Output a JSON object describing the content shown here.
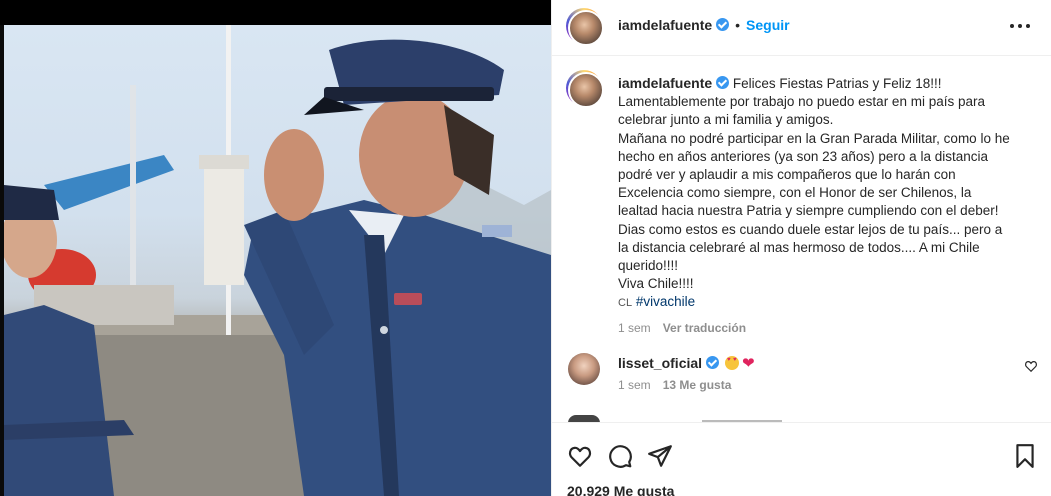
{
  "post": {
    "author": "iamdelafuente",
    "follow_label": "Seguir",
    "caption_author": "iamdelafuente",
    "caption_lines": [
      "Felices Fiestas Patrias y Feliz 18!!!",
      "Lamentablemente por trabajo no puedo estar en mi país para celebrar junto a mi familia y amigos.",
      "Mañana no podré participar en la Gran Parada Militar, como lo he hecho en años anteriores (ya son 23 años) pero a la distancia podré ver y aplaudir a mis compañeros que lo harán con Excelencia como siempre, con el Honor de ser Chilenos, la lealtad hacia nuestra Patria y siempre cumpliendo con el deber!",
      "Dias como estos es cuando duele estar lejos de tu país... pero a la distancia celebraré al mas hermoso de todos.... A mi Chile querido!!!!",
      "Viva Chile!!!!"
    ],
    "flag_text": "CL",
    "hashtag": "#vivachile",
    "time": "1 sem",
    "translate_label": "Ver traducción",
    "likes_label": "20.929 Me gusta"
  },
  "comment": {
    "author": "lisset_oficial",
    "time": "1 sem",
    "likes_label": "13 Me gusta"
  },
  "icons": [
    "verified-badge-icon",
    "more-options-icon",
    "heart-icon",
    "comment-icon",
    "share-icon",
    "bookmark-icon"
  ],
  "colors": {
    "accent": "#0095f6",
    "text": "#262626",
    "muted": "#8e8e8e",
    "verified": "#3897f0",
    "border": "#efefef"
  }
}
